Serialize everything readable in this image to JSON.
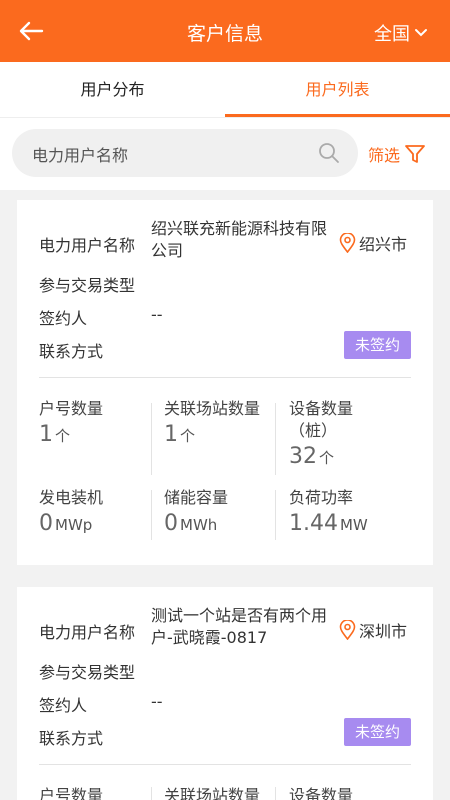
{
  "header": {
    "title": "客户信息",
    "region": "全国"
  },
  "tabs": [
    {
      "label": "用户分布",
      "active": false
    },
    {
      "label": "用户列表",
      "active": true
    }
  ],
  "search": {
    "placeholder": "电力用户名称",
    "filter_label": "筛选"
  },
  "labels": {
    "user_name": "电力用户名称",
    "trade_type": "参与交易类型",
    "signer": "签约人",
    "contact": "联系方式",
    "account_count": "户号数量",
    "station_count": "关联场站数量",
    "device_count": "设备数量",
    "device_count_sub": "（桩）",
    "generator": "发电装机",
    "storage": "储能容量",
    "load_power": "负荷功率"
  },
  "cards": [
    {
      "name": "绍兴联充新能源科技有限公司",
      "city": "绍兴市",
      "trade_type": "",
      "signer": "--",
      "contact": "",
      "status": "未签约",
      "account_count": "1",
      "account_unit": "个",
      "station_count": "1",
      "station_unit": "个",
      "device_count": "32",
      "device_unit": "个",
      "generator": "0",
      "generator_unit": "MWp",
      "storage": "0",
      "storage_unit": "MWh",
      "load_power": "1.44",
      "load_unit": "MW"
    },
    {
      "name": "测试一个站是否有两个用户-武晓霞-0817",
      "city": "深圳市",
      "trade_type": "",
      "signer": "--",
      "contact": "",
      "status": "未签约"
    }
  ],
  "colors": {
    "accent": "#fb6a1e",
    "badge": "#a78bf0"
  }
}
